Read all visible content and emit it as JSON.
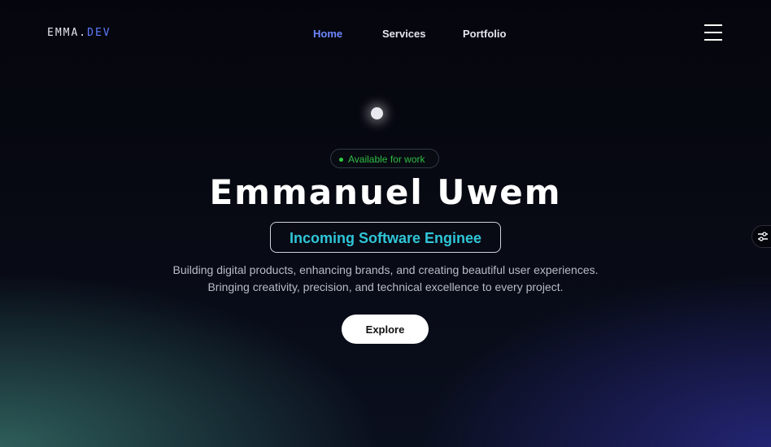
{
  "logo": {
    "main": "EMMA.",
    "accent": "DEV"
  },
  "nav": {
    "links": [
      "Home",
      "Services",
      "Portfolio"
    ],
    "active": "Home"
  },
  "hero": {
    "status": "Available for work",
    "name": "Emmanuel Uwem",
    "role": "Incoming Software Enginee",
    "description_line1": "Building digital products, enhancing brands, and creating beautiful user experiences.",
    "description_line2": "Bringing creativity, precision, and technical excellence to every project.",
    "cta": "Explore"
  },
  "icons": {
    "menu": "hamburger-menu-icon",
    "side": "settings-sliders-icon",
    "status": "status-dot-icon"
  },
  "colors": {
    "accent": "#6e87ff",
    "status_green": "#2fbe44",
    "role_text": "#2fc6d8",
    "background": "#05060d"
  }
}
